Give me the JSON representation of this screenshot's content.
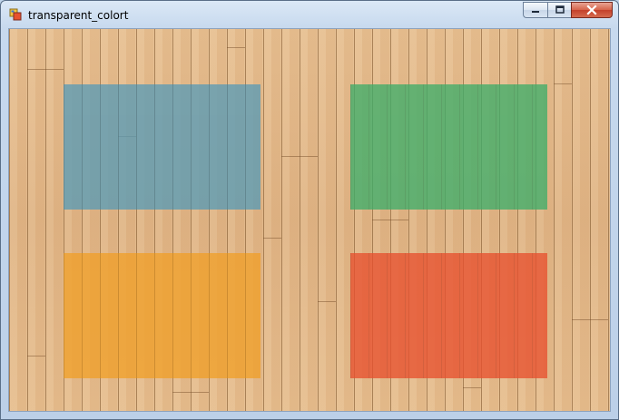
{
  "window": {
    "title": "transparent_colort"
  },
  "caption_buttons": {
    "minimize_icon": "minimize-icon",
    "maximize_icon": "maximize-icon",
    "close_icon": "close-icon"
  },
  "panels": [
    {
      "name": "blue",
      "color": "#5a9bb5"
    },
    {
      "name": "green",
      "color": "#3fae6a"
    },
    {
      "name": "orange",
      "color": "#f0a02a"
    },
    {
      "name": "red",
      "color": "#e8512f"
    }
  ],
  "background": {
    "type": "wood-floor",
    "color": "#e3b98a"
  }
}
